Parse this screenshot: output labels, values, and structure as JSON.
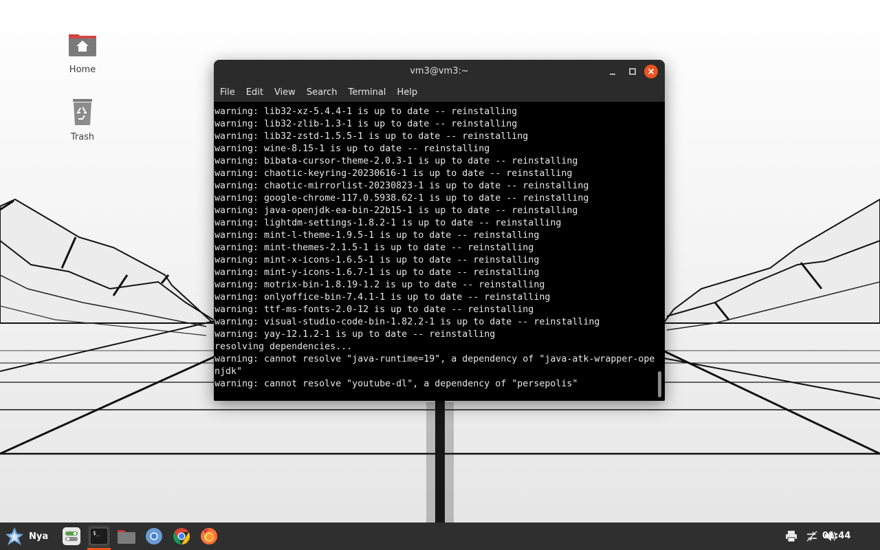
{
  "desktop": {
    "icons": [
      {
        "label": "Home"
      },
      {
        "label": "Trash"
      }
    ]
  },
  "terminal": {
    "title": "vm3@vm3:~",
    "menu": [
      "File",
      "Edit",
      "View",
      "Search",
      "Terminal",
      "Help"
    ],
    "lines": [
      "warning: lib32-xz-5.4.4-1 is up to date -- reinstalling",
      "warning: lib32-zlib-1.3-1 is up to date -- reinstalling",
      "warning: lib32-zstd-1.5.5-1 is up to date -- reinstalling",
      "warning: wine-8.15-1 is up to date -- reinstalling",
      "warning: bibata-cursor-theme-2.0.3-1 is up to date -- reinstalling",
      "warning: chaotic-keyring-20230616-1 is up to date -- reinstalling",
      "warning: chaotic-mirrorlist-20230823-1 is up to date -- reinstalling",
      "warning: google-chrome-117.0.5938.62-1 is up to date -- reinstalling",
      "warning: java-openjdk-ea-bin-22b15-1 is up to date -- reinstalling",
      "warning: lightdm-settings-1.8.2-1 is up to date -- reinstalling",
      "warning: mint-l-theme-1.9.5-1 is up to date -- reinstalling",
      "warning: mint-themes-2.1.5-1 is up to date -- reinstalling",
      "warning: mint-x-icons-1.6.5-1 is up to date -- reinstalling",
      "warning: mint-y-icons-1.6.7-1 is up to date -- reinstalling",
      "warning: motrix-bin-1.8.19-1.2 is up to date -- reinstalling",
      "warning: onlyoffice-bin-7.4.1-1 is up to date -- reinstalling",
      "warning: ttf-ms-fonts-2.0-12 is up to date -- reinstalling",
      "warning: visual-studio-code-bin-1.82.2-1 is up to date -- reinstalling",
      "warning: yay-12.1.2-1 is up to date -- reinstalling",
      "resolving dependencies...",
      "warning: cannot resolve \"java-runtime=19\", a dependency of \"java-atk-wrapper-openjdk\"",
      "warning: cannot resolve \"youtube-dl\", a dependency of \"persepolis\""
    ]
  },
  "taskbar": {
    "menu_label": "Nya",
    "apps": [
      {
        "icon": "settings-toggle-icon"
      },
      {
        "icon": "terminal-icon",
        "active": true
      },
      {
        "icon": "folder-icon"
      },
      {
        "icon": "chromium-icon"
      },
      {
        "icon": "chrome-icon"
      },
      {
        "icon": "firefox-icon"
      }
    ],
    "tray": [
      "printer-icon",
      "network-icon",
      "volume-icon"
    ],
    "clock": "01:44"
  },
  "colors": {
    "accent": "#e95420",
    "terminal_bg": "#000000",
    "terminal_fg": "#e8e8e8",
    "titlebar": "#2b2b2b",
    "taskbar": "#2f2f2f"
  }
}
